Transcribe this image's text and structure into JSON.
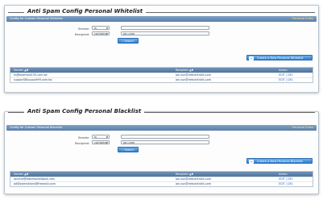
{
  "sections": [
    {
      "title": "Anti Spam Config Personal Whitelist",
      "bar_title": "Config for Custom Personal Whitelist",
      "bar_link": "Personal Rules",
      "form": {
        "sender_label": "Sender",
        "sender_op": "is",
        "sender_value": "",
        "recipient_label": "Recipient",
        "recipient_op": "contains",
        "recipient_value": "jon.com",
        "search_label": "Search"
      },
      "new_button": "Create a New Personal Whitelist",
      "table": {
        "headers": [
          "Sender ▲▼",
          "Recipient ▲▼",
          "Action"
        ],
        "rows": [
          [
            "ks@example135.com.tw",
            "jon.sun@netcontrolls.com",
            "EDIT | DEL"
          ],
          [
            "support@support99.com.tw",
            "jon.sun@netcontrolls.com",
            "EDIT | DEL"
          ]
        ]
      }
    },
    {
      "title": "Anti Spam Config Personal Blacklist",
      "bar_title": "Config for Custom Personal Blacklist",
      "bar_link": "Personal Rules",
      "form": {
        "sender_label": "Sender",
        "sender_op": "is",
        "sender_value": "",
        "recipient_label": "Recipient",
        "recipient_op": "contains",
        "recipient_value": "jon.com",
        "search_label": "Search"
      },
      "new_button": "Create a New Personal Blacklist",
      "table": {
        "headers": [
          "Sender ▲▼",
          "Recipient ▲▼",
          "Action"
        ],
        "rows": [
          [
            "service@fakemarketbank.com",
            "jon.sun@netcontrolls.com",
            "EDIT | DEL"
          ],
          [
            "ad@promotions@freeonly.com",
            "jon.sun@netcontrolls.com",
            "EDIT | DEL"
          ]
        ]
      }
    }
  ],
  "colors": {
    "bar": "#5b7fa8",
    "button": "#2f7fcf",
    "link": "#ffe27a"
  }
}
